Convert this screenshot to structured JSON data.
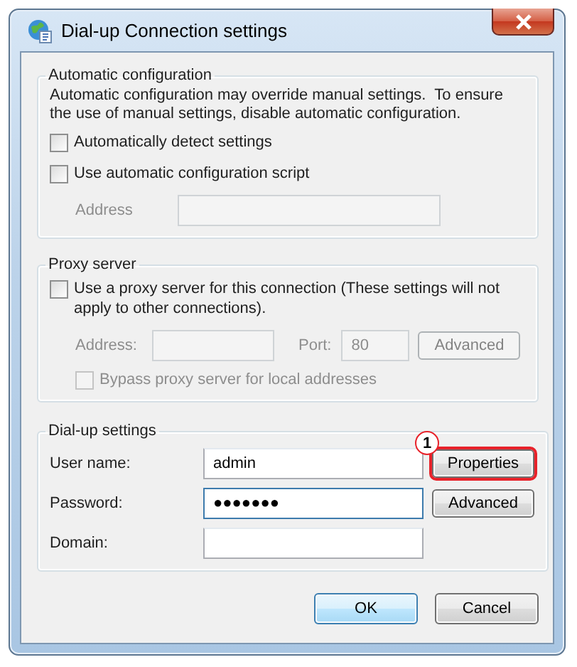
{
  "window": {
    "title": "Dial-up Connection settings"
  },
  "automatic_configuration": {
    "legend": "Automatic configuration",
    "note": "Automatic configuration may override manual settings.  To ensure the use of manual settings, disable automatic configuration.",
    "checkboxes": [
      {
        "label": "Automatically detect settings",
        "checked": false
      },
      {
        "label": "Use automatic configuration script",
        "checked": false
      }
    ],
    "address": {
      "label": "Address",
      "disabled": true
    }
  },
  "proxy_server": {
    "legend": "Proxy server",
    "use_proxy": {
      "label": "Use a proxy server for this connection (These settings will not apply to other connections).",
      "checked": false
    },
    "address": {
      "label": "Address:",
      "disabled": true
    },
    "port": {
      "label": "Port:",
      "value": "80",
      "disabled": true
    },
    "advanced_button": {
      "label": "Advanced",
      "disabled": true
    },
    "bypass": {
      "label": "Bypass proxy server for local addresses",
      "checked": false,
      "disabled": true
    }
  },
  "dialup_settings": {
    "legend": "Dial-up settings",
    "fields": [
      {
        "label": "User name:",
        "value": "admin",
        "focused": false
      },
      {
        "label": "Password:",
        "value": "●●●●●●●",
        "focused": true
      },
      {
        "label": "Domain:",
        "focused": false
      }
    ],
    "buttons": [
      {
        "label": "Properties",
        "highlighted": true,
        "callout": "1"
      },
      {
        "label": "Advanced",
        "highlighted": false
      }
    ]
  },
  "buttons": [
    {
      "label": "OK",
      "default": true
    },
    {
      "label": "Cancel",
      "default": false
    }
  ]
}
